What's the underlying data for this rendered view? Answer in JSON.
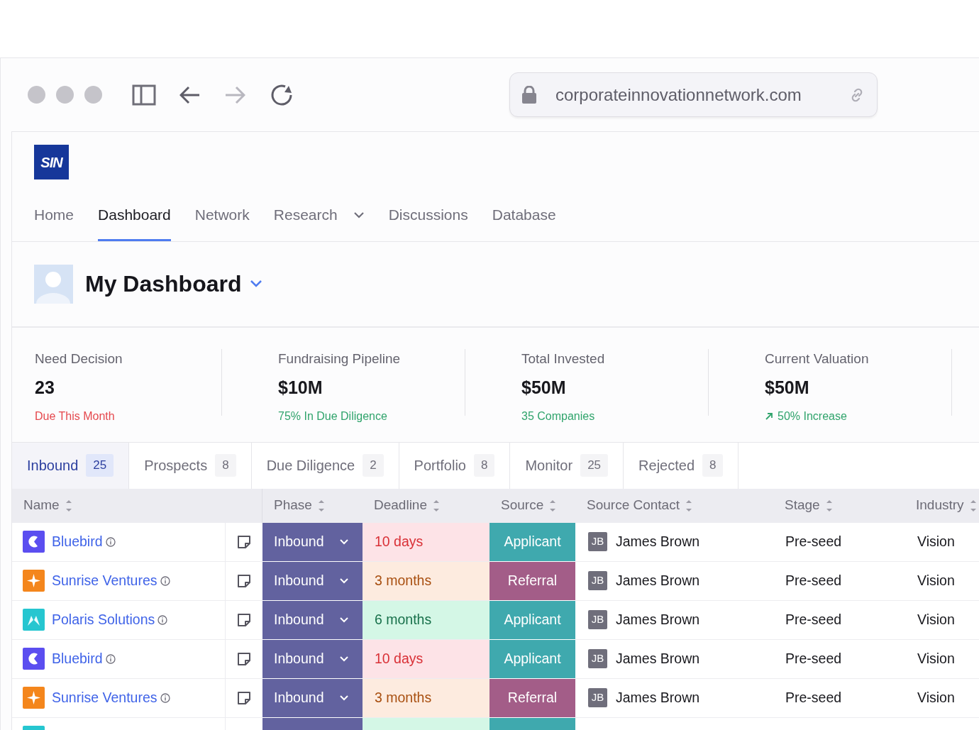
{
  "browser": {
    "url": "corporateinnovationnetwork.com",
    "back_enabled": true,
    "forward_enabled": false
  },
  "logo": "SIN",
  "nav": [
    {
      "label": "Home",
      "selected": false,
      "dropdown": false
    },
    {
      "label": "Dashboard",
      "selected": true,
      "dropdown": false
    },
    {
      "label": "Network",
      "selected": false,
      "dropdown": false
    },
    {
      "label": "Research",
      "selected": false,
      "dropdown": true
    },
    {
      "label": "Discussions",
      "selected": false,
      "dropdown": false
    },
    {
      "label": "Database",
      "selected": false,
      "dropdown": false
    }
  ],
  "dashboard": {
    "title": "My Dashboard"
  },
  "stats": [
    {
      "label": "Need Decision",
      "value": "23",
      "note": {
        "text": "Due This Month",
        "color": "#e5484d"
      },
      "trend": false
    },
    {
      "label": "Fundraising Pipeline",
      "value": "$10M",
      "note": {
        "text": "75% In Due Diligence",
        "color": "#30a46c"
      },
      "trend": false
    },
    {
      "label": "Total Invested",
      "value": "$50M",
      "note": {
        "text": "35 Companies",
        "color": "#30a46c"
      },
      "trend": false
    },
    {
      "label": "Current Valuation",
      "value": "$50M",
      "note": {
        "text": "50% Increase",
        "color": "#30a46c"
      },
      "trend": true
    }
  ],
  "tabs": [
    {
      "label": "Inbound",
      "count": "25",
      "selected": true
    },
    {
      "label": "Prospects",
      "count": "8",
      "selected": false
    },
    {
      "label": "Due Diligence",
      "count": "2",
      "selected": false
    },
    {
      "label": "Portfolio",
      "count": "8",
      "selected": false
    },
    {
      "label": "Monitor",
      "count": "25",
      "selected": false
    },
    {
      "label": "Rejected",
      "count": "8",
      "selected": false
    }
  ],
  "table": {
    "columns": [
      "Name",
      "Phase",
      "Deadline",
      "Source",
      "Source Contact",
      "Stage",
      "Industry"
    ],
    "rows": [
      {
        "kind": "full",
        "logo": {
          "kind": "moon"
        },
        "name": "Bluebird",
        "phase": "Inbound",
        "deadline": {
          "text": "10 days",
          "color": "#fde3e7"
        },
        "source": {
          "text": "Applicant",
          "color": "#3fa9ae"
        },
        "contact_initials": "JB",
        "contact": "James Brown",
        "stage": "Pre-seed",
        "industry": "Vision"
      },
      {
        "kind": "full",
        "logo": {
          "kind": "star"
        },
        "name": "Sunrise Ventures",
        "phase": "Inbound",
        "deadline": {
          "text": "3 months",
          "color": "#fdebdf"
        },
        "source": {
          "text": "Referral",
          "color": "#a35d88"
        },
        "contact_initials": "JB",
        "contact": "James Brown",
        "stage": "Pre-seed",
        "industry": "Vision"
      },
      {
        "kind": "full",
        "logo": {
          "kind": "peaks"
        },
        "name": "Polaris Solutions",
        "phase": "Inbound",
        "deadline": {
          "text": "6 months",
          "color": "#d4f7e6"
        },
        "source": {
          "text": "Applicant",
          "color": "#3fa9ae"
        },
        "contact_initials": "JB",
        "contact": "James Brown",
        "stage": "Pre-seed",
        "industry": "Vision"
      },
      {
        "kind": "full",
        "logo": {
          "kind": "moon"
        },
        "name": "Bluebird",
        "phase": "Inbound",
        "deadline": {
          "text": "10 days",
          "color": "#fde3e7"
        },
        "source": {
          "text": "Applicant",
          "color": "#3fa9ae"
        },
        "contact_initials": "JB",
        "contact": "James Brown",
        "stage": "Pre-seed",
        "industry": "Vision"
      },
      {
        "kind": "full",
        "logo": {
          "kind": "star"
        },
        "name": "Sunrise Ventures",
        "phase": "Inbound",
        "deadline": {
          "text": "3 months",
          "color": "#fdebdf"
        },
        "source": {
          "text": "Referral",
          "color": "#a35d88"
        },
        "contact_initials": "JB",
        "contact": "James Brown",
        "stage": "Pre-seed",
        "industry": "Vision"
      },
      {
        "kind": "partial",
        "logo": {
          "kind": "peaks"
        },
        "deadline": {
          "color": "#d4f7e6"
        },
        "source": {
          "color": "#3fa9ae"
        }
      }
    ]
  }
}
